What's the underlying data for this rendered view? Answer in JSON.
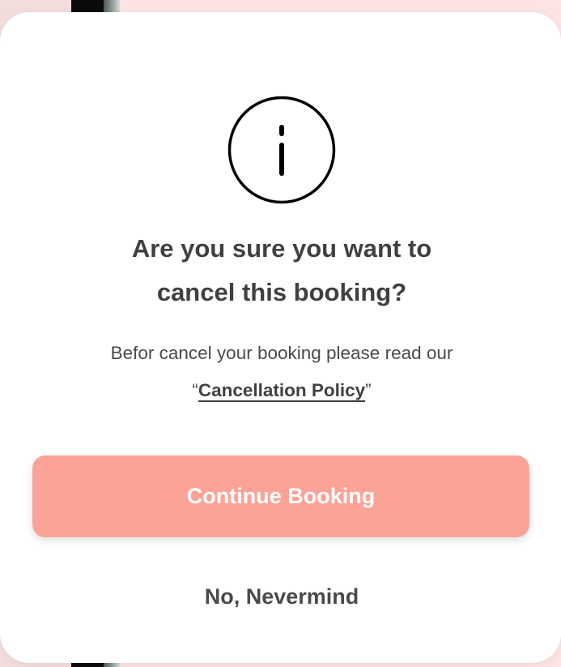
{
  "dialog": {
    "title_line1": "Are you sure you want to",
    "title_line2": "cancel this booking?",
    "body": "Befor cancel your booking please read our",
    "policy_open_quote": "“",
    "policy_link": "Cancellation Policy",
    "policy_close_quote": "”",
    "primary_button": "Continue Booking",
    "secondary_button": "No, Nevermind",
    "icon": "info-icon"
  },
  "colors": {
    "primary_button_bg": "#fba397",
    "title_text": "#404040",
    "body_text": "#4a4a4a",
    "backdrop": "#fbe4e2"
  }
}
